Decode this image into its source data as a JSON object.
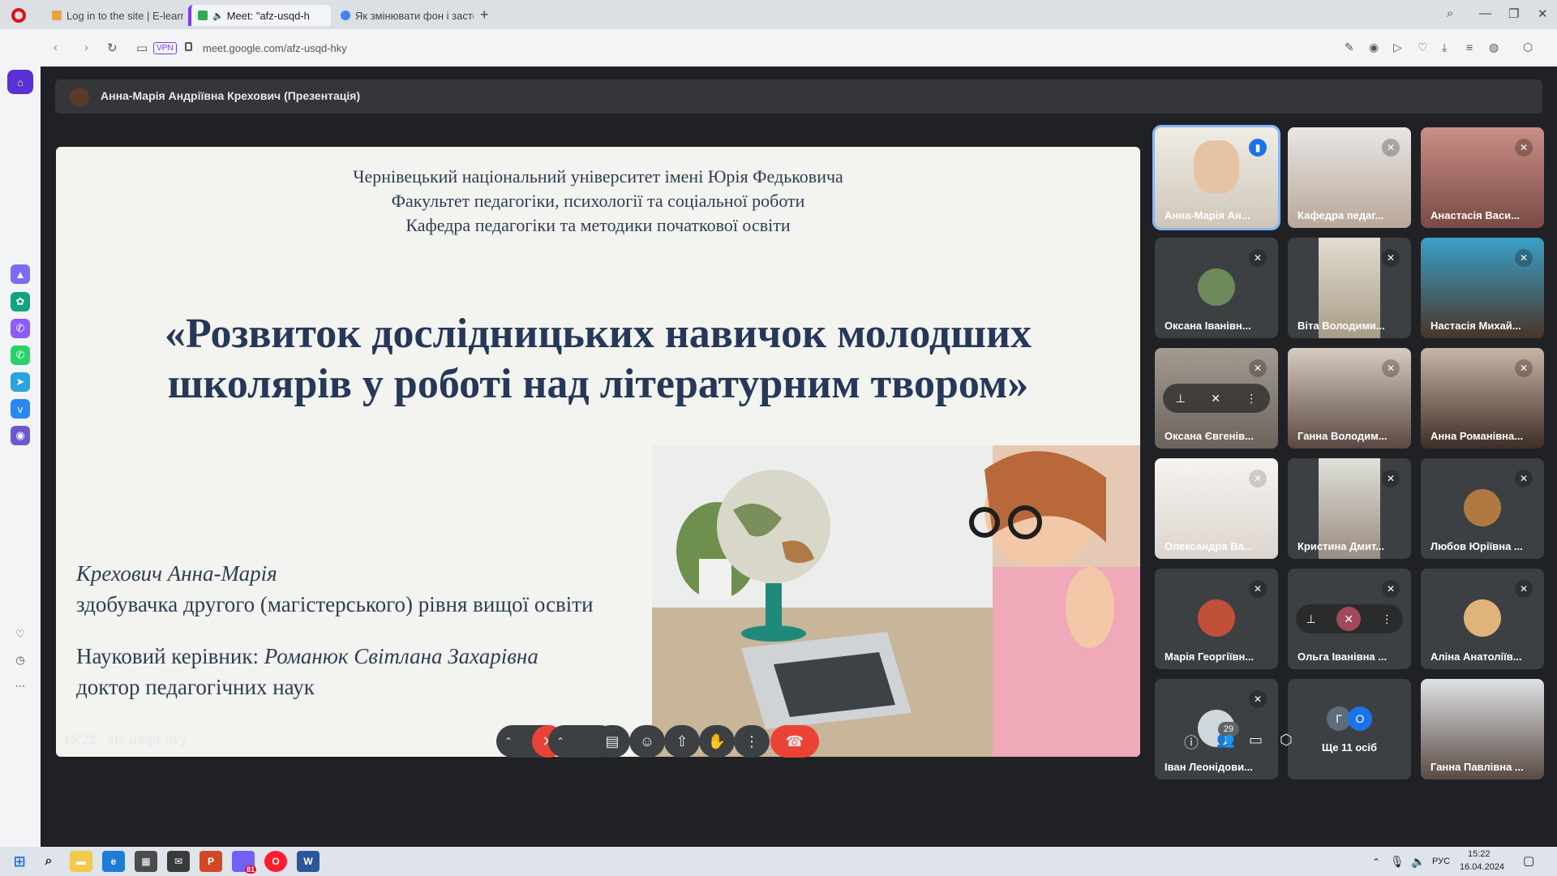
{
  "browser": {
    "tabs": [
      {
        "label": "Log in to the site | E-learni"
      },
      {
        "label": "Meet: \"afz-usqd-h"
      },
      {
        "label": "Як змінювати фон і засто"
      }
    ],
    "url": "meet.google.com/afz-usqd-hky",
    "vpn": "VPN"
  },
  "meet": {
    "presenter_bar": "Анна-Марія Андріївна Крехович (Презентація)",
    "slide": {
      "university": "Чернівецький національний університет імені Юрія Федьковича",
      "faculty": "Факультет педагогіки, психології та соціальної роботи",
      "department": "Кафедра педагогіки та методики початкової освіти",
      "title_line1": "«Розвиток дослідницьких навичок молодших",
      "title_line2": "школярів у роботі над літературним твором»",
      "author_name": "Крехович Анна-Марія",
      "author_degree": "здобувачка другого (магістерського) рівня вищої освіти",
      "advisor_label": "Науковий керівник: ",
      "advisor_name": "Романюк Світлана Захарівна",
      "advisor_degree": "доктор педагогічних наук"
    },
    "participants": [
      {
        "name": "Анна-Марія Ан..."
      },
      {
        "name": "Кафедра педаг..."
      },
      {
        "name": "Анастасія Васи..."
      },
      {
        "name": "Оксана Іванівн..."
      },
      {
        "name": "Віта Володими..."
      },
      {
        "name": "Настасія Михай..."
      },
      {
        "name": "Оксана Євгенів..."
      },
      {
        "name": "Ганна Володим..."
      },
      {
        "name": "Анна Романівна..."
      },
      {
        "name": "Олександра Ва..."
      },
      {
        "name": "Кристина Дмит..."
      },
      {
        "name": "Любов Юріївна ..."
      },
      {
        "name": "Марія Георгіївн..."
      },
      {
        "name": "Ольга Іванівна ..."
      },
      {
        "name": "Аліна Анатоліїв..."
      },
      {
        "name": "Іван Леонідови..."
      },
      {
        "name": "Ще 11 осіб",
        "initials": [
          "Г",
          "О"
        ]
      },
      {
        "name": "Ганна Павлівна ..."
      }
    ],
    "time": "15:22",
    "meeting_code": "afz-usqd-hky",
    "people_count": "29"
  },
  "taskbar": {
    "lang": "РУС",
    "time": "15:22",
    "date": "16.04.2024",
    "viber_badge": "81"
  }
}
